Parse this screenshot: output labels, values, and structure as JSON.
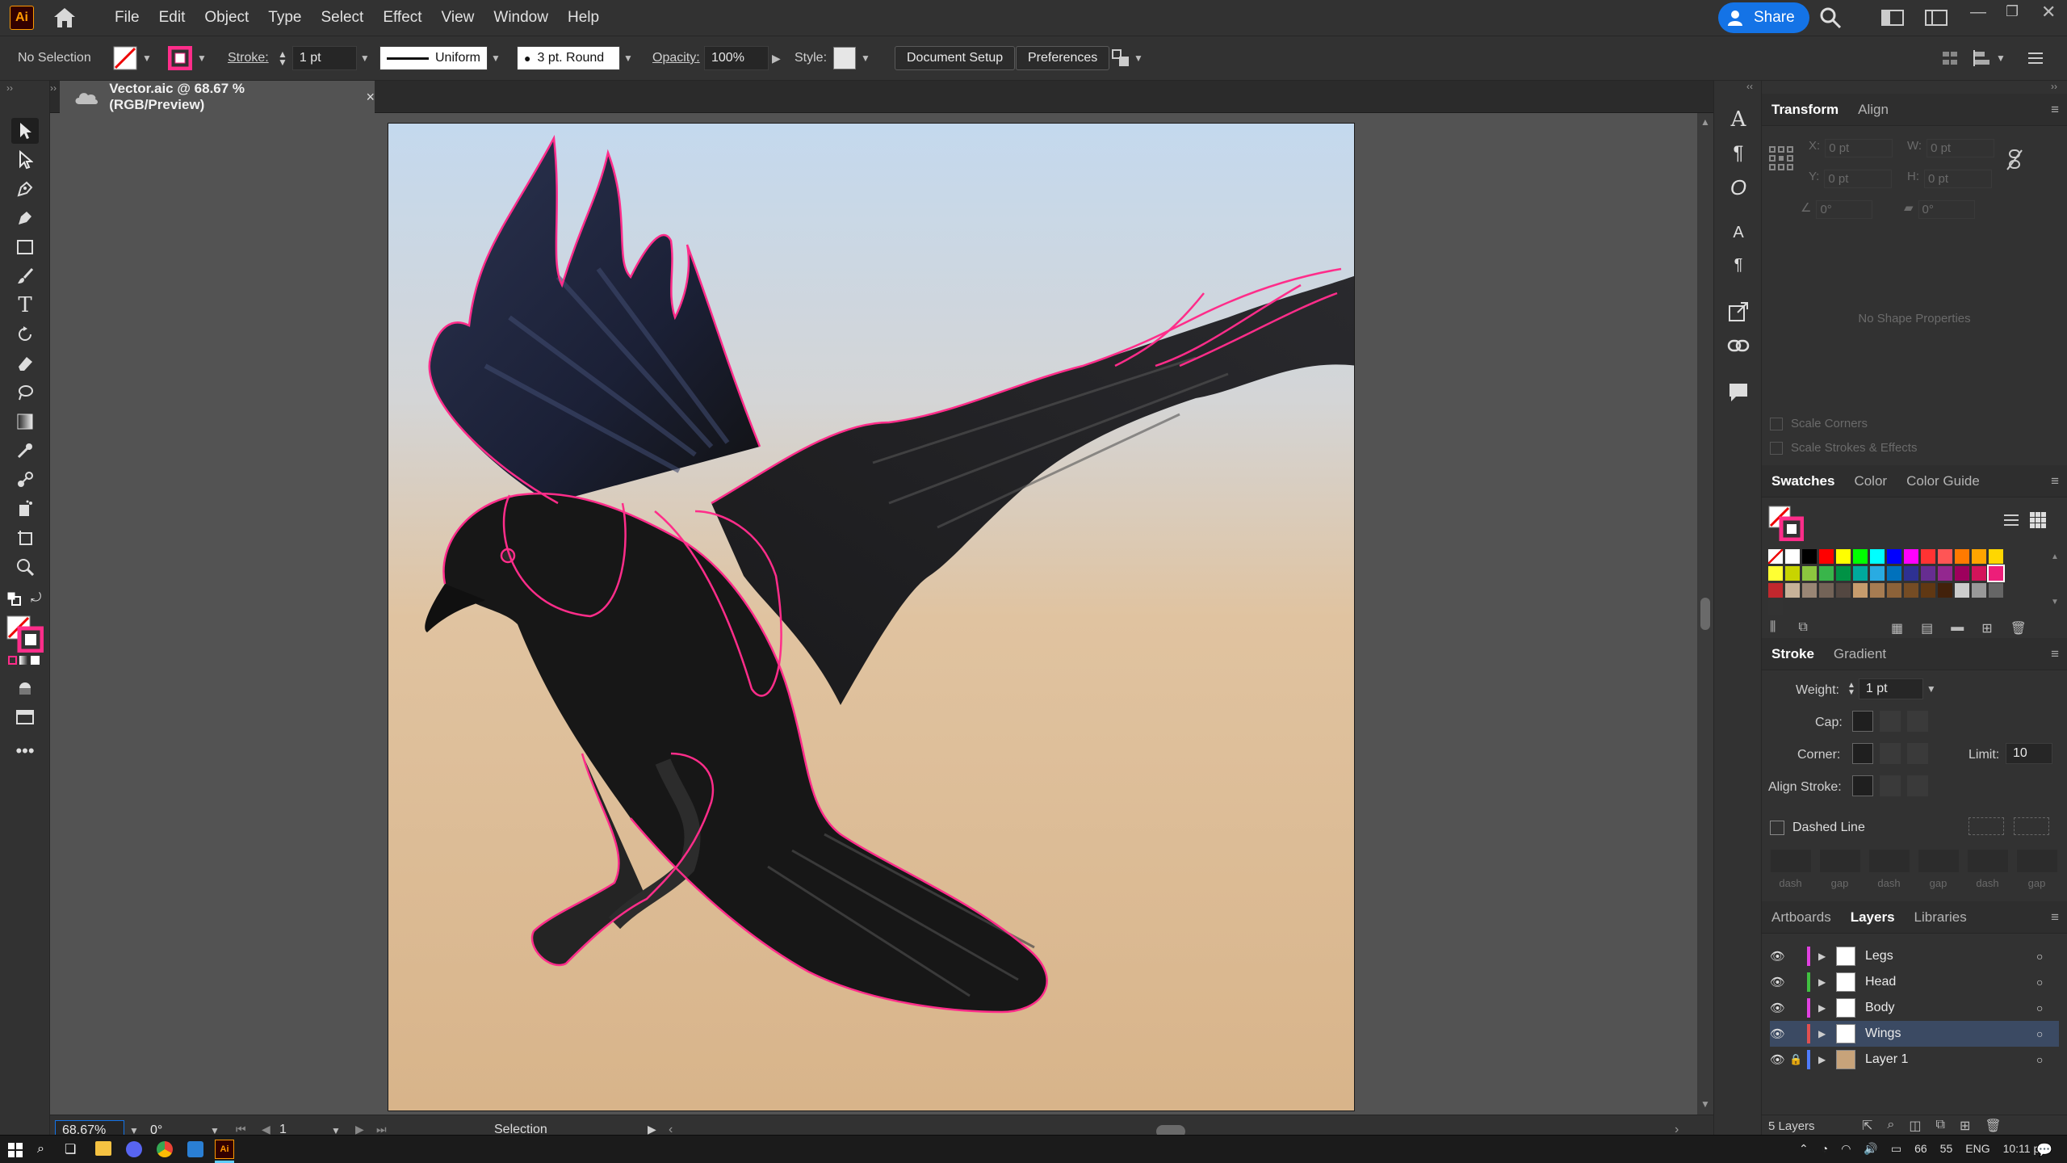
{
  "app": {
    "logo": "Ai"
  },
  "menu": [
    "File",
    "Edit",
    "Object",
    "Type",
    "Select",
    "Effect",
    "View",
    "Window",
    "Help"
  ],
  "header": {
    "share_label": "Share"
  },
  "control_bar": {
    "selection": "No Selection",
    "stroke_label": "Stroke:",
    "stroke_weight": "1 pt",
    "profile": "Uniform",
    "brush": "3 pt. Round",
    "opacity_label": "Opacity:",
    "opacity_value": "100%",
    "style_label": "Style:",
    "document_setup": "Document Setup",
    "preferences": "Preferences"
  },
  "document": {
    "tab_title": "Vector.aic @ 68.67 % (RGB/Preview)",
    "close": "×"
  },
  "status": {
    "zoom": "68.67%",
    "rotation": "0°",
    "artboard_num": "1",
    "tool": "Selection"
  },
  "transform_panel": {
    "tabs": [
      "Transform",
      "Align"
    ],
    "x_label": "X:",
    "x": "0 pt",
    "w_label": "W:",
    "w": "0 pt",
    "y_label": "Y:",
    "y": "0 pt",
    "h_label": "H:",
    "h": "0 pt",
    "angle": "0°",
    "shear": "0°",
    "no_shape": "No Shape Properties",
    "scale_corners": "Scale Corners",
    "scale_strokes": "Scale Strokes & Effects"
  },
  "swatches_panel": {
    "tabs": [
      "Swatches",
      "Color",
      "Color Guide"
    ]
  },
  "stroke_panel": {
    "tabs": [
      "Stroke",
      "Gradient"
    ],
    "weight_label": "Weight:",
    "weight": "1 pt",
    "cap_label": "Cap:",
    "corner_label": "Corner:",
    "limit_label": "Limit:",
    "limit": "10",
    "align_label": "Align Stroke:",
    "dashed": "Dashed Line",
    "dash_labels": [
      "dash",
      "gap",
      "dash",
      "gap",
      "dash",
      "gap"
    ]
  },
  "layers_panel": {
    "tabs": [
      "Artboards",
      "Layers",
      "Libraries"
    ],
    "layers": [
      {
        "name": "Legs",
        "color": "#e040e0"
      },
      {
        "name": "Head",
        "color": "#40c040"
      },
      {
        "name": "Body",
        "color": "#e040e0"
      },
      {
        "name": "Wings",
        "color": "#e05050"
      },
      {
        "name": "Layer 1",
        "color": "#4f7cff"
      }
    ],
    "count": "5 Layers"
  },
  "taskbar": {
    "lang": "ENG",
    "time": "10:11 pm",
    "weather": "66",
    "wind": "55"
  },
  "colors": {
    "accent": "#1473e6",
    "selection_path": "#ff2d8a"
  },
  "swatch_colors": [
    "#ffffff",
    "#000000",
    "#ff0000",
    "#ffff00",
    "#00ff00",
    "#00ffff",
    "#0000ff",
    "#ff00ff",
    "#ff3333",
    "#ff5555",
    "#ff7a00",
    "#ffa500",
    "#ffd700",
    "#ffff33",
    "#c8d400",
    "#8cc63f",
    "#39b54a",
    "#009245",
    "#00a99d",
    "#29abe2",
    "#0071bc",
    "#2e3192",
    "#662d91",
    "#93278f",
    "#9e005d",
    "#d4145a",
    "#ed1e79",
    "#c1272d",
    "#c7b299",
    "#998675",
    "#736357",
    "#534741",
    "#c69c6d",
    "#a67c52",
    "#8c6239",
    "#754c24",
    "#603813",
    "#42210b",
    "#cccccc",
    "#999999",
    "#666666",
    "#333333"
  ]
}
